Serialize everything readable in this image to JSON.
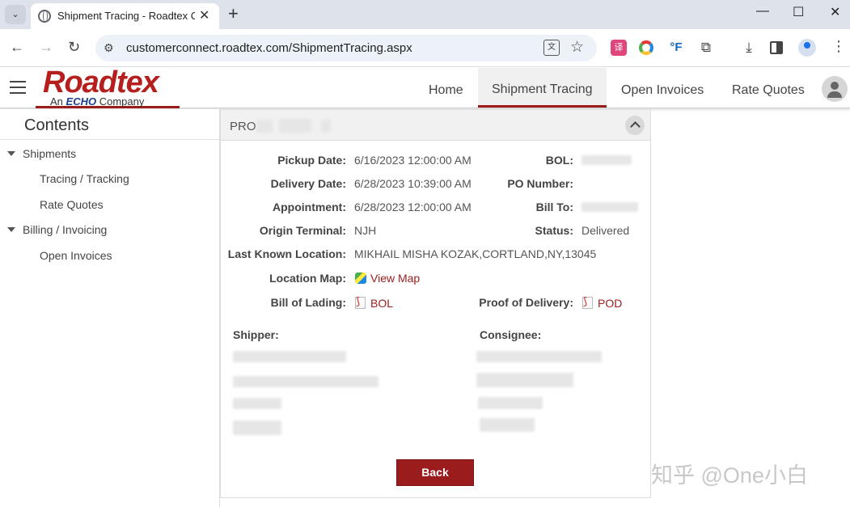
{
  "browser": {
    "tab_title": "Shipment Tracing - Roadtex C",
    "url": "customerconnect.roadtex.com/ShipmentTracing.aspx",
    "new_tab": "+",
    "close": "✕",
    "minimize": "—",
    "maximize": "☐",
    "win_close": "✕"
  },
  "site": {
    "logo": "Roadtex",
    "logo_sub_prefix": "An",
    "logo_sub_brand": "ECHO",
    "logo_sub_suffix": "Company",
    "nav": [
      "Home",
      "Shipment Tracing",
      "Open Invoices",
      "Rate Quotes"
    ],
    "active_nav": "Shipment Tracing"
  },
  "sidebar": {
    "title": "Contents",
    "groups": [
      {
        "label": "Shipments",
        "items": [
          "Tracing / Tracking",
          "Rate Quotes"
        ]
      },
      {
        "label": "Billing / Invoicing",
        "items": [
          "Open Invoices"
        ]
      }
    ]
  },
  "shipment": {
    "pro_label": "PRO",
    "fields_left": [
      {
        "label": "Pickup Date:",
        "value": "6/16/2023 12:00:00 AM"
      },
      {
        "label": "Delivery Date:",
        "value": "6/28/2023 10:39:00 AM"
      },
      {
        "label": "Appointment:",
        "value": "6/28/2023 12:00:00 AM"
      },
      {
        "label": "Origin Terminal:",
        "value": "NJH"
      },
      {
        "label": "Last Known Location:",
        "value": "MIKHAIL MISHA KOZAK,CORTLAND,NY,13045"
      }
    ],
    "fields_right": [
      {
        "label": "BOL:",
        "value": ""
      },
      {
        "label": "PO Number:",
        "value": ""
      },
      {
        "label": "Bill To:",
        "value": ""
      },
      {
        "label": "Status:",
        "value": "Delivered"
      }
    ],
    "location_map_label": "Location Map:",
    "location_map_link": "View Map",
    "bill_of_lading_label": "Bill of Lading:",
    "bill_of_lading_link": "BOL",
    "proof_of_delivery_label": "Proof of Delivery:",
    "proof_of_delivery_link": "POD",
    "shipper_label": "Shipper:",
    "consignee_label": "Consignee:",
    "back_button": "Back"
  },
  "watermark": "知乎 @One小白",
  "colors": {
    "brand": "#b5201f",
    "brand_dark": "#9b1c1c",
    "echo_blue": "#1b3f8f"
  }
}
